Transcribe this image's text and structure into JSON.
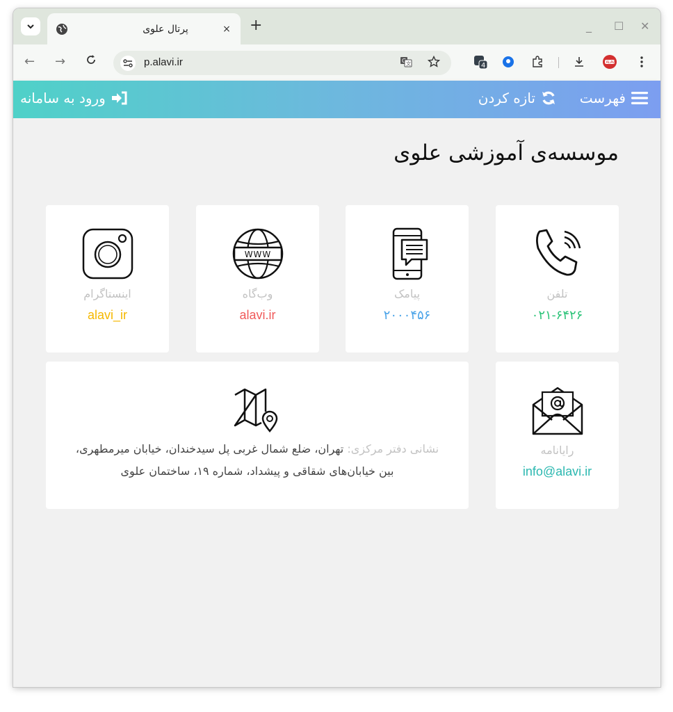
{
  "browser": {
    "tab_title": "پرتال علوی",
    "tab_close": "×",
    "new_tab": "+",
    "url": "p.alavi.ir",
    "extension_badge": "4",
    "controls": {
      "minimize": "_",
      "maximize": "☐",
      "close": "✕"
    }
  },
  "appbar": {
    "menu_label": "فهرست",
    "refresh_label": "تازه کردن",
    "login_label": "ورود به سامانه"
  },
  "page": {
    "title": "موسسه‌ی آموزشی علوی"
  },
  "cards": {
    "phone": {
      "label": "تلفن",
      "value": "۰۲۱-۶۴۲۶",
      "color": "#2ec47a"
    },
    "sms": {
      "label": "پیامک",
      "value": "۲۰۰۰۴۵۶",
      "color": "#4aa3e8"
    },
    "web": {
      "label": "وب‌گاه",
      "value": "alavi.ir",
      "color": "#f05a5a"
    },
    "instagram": {
      "label": "اینستاگرام",
      "value": "alavi_ir",
      "color": "#f5b800"
    },
    "email": {
      "label": "رایانامه",
      "value": "info@alavi.ir",
      "color": "#2bb8b0"
    },
    "address": {
      "label": "نشانی دفتر مرکزی:",
      "value": "تهران، ضلع شمال غربی پل سیدخندان، خیابان میرمطهری، بین خیابان‌های شقاقی و پیشداد، شماره ۱۹، ساختمان علوی"
    }
  },
  "icons": {
    "phone": "phone-icon",
    "sms": "mobile-message-icon",
    "web": "globe-www-icon",
    "instagram": "instagram-icon",
    "email": "envelope-at-icon",
    "address": "map-pin-icon"
  }
}
